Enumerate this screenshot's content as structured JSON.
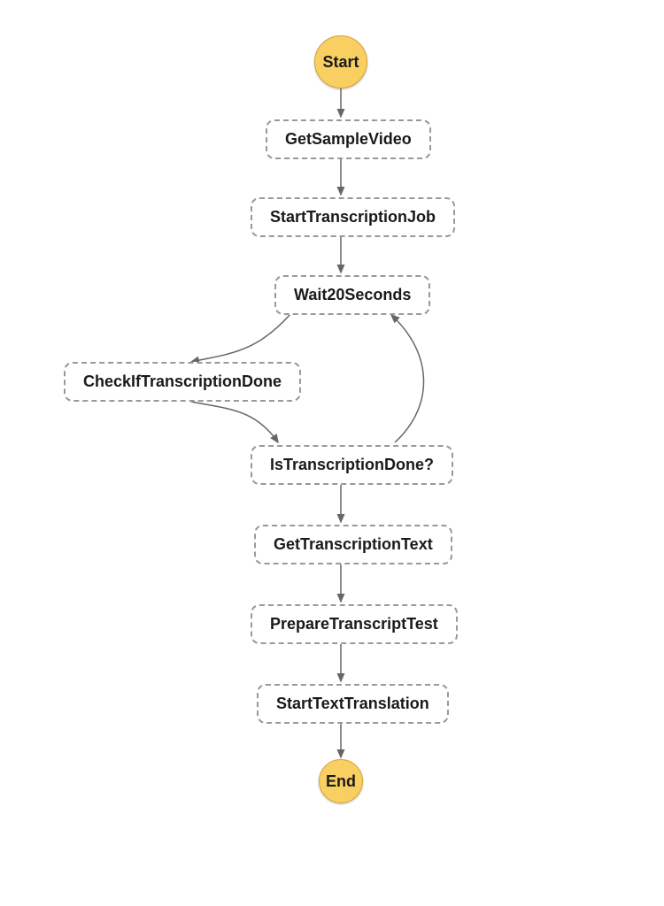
{
  "start": {
    "label": "Start"
  },
  "end": {
    "label": "End"
  },
  "steps": {
    "getSampleVideo": {
      "label": "GetSampleVideo"
    },
    "startTranscriptionJob": {
      "label": "StartTranscriptionJob"
    },
    "wait20Seconds": {
      "label": "Wait20Seconds"
    },
    "checkIfTranscriptionDone": {
      "label": "CheckIfTranscriptionDone"
    },
    "isTranscriptionDone": {
      "label": "IsTranscriptionDone?"
    },
    "getTranscriptionText": {
      "label": "GetTranscriptionText"
    },
    "prepareTranscriptTest": {
      "label": "PrepareTranscriptTest"
    },
    "startTextTranslation": {
      "label": "StartTextTranslation"
    }
  },
  "colors": {
    "terminalFill": "#f9cf62",
    "terminalStroke": "#d4a43c",
    "nodeBorder": "#999999",
    "arrow": "#666666",
    "text": "#1a1a1a"
  }
}
